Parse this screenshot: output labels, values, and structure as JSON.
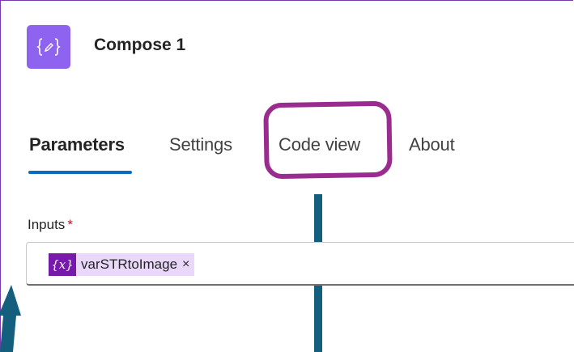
{
  "action": {
    "title": "Compose 1",
    "icon": "compose-icon",
    "icon_color": "#8e63f0"
  },
  "tabs": [
    {
      "label": "Parameters",
      "active": true
    },
    {
      "label": "Settings",
      "active": false
    },
    {
      "label": "Code view",
      "active": false
    },
    {
      "label": "About",
      "active": false
    }
  ],
  "parameters": {
    "inputs_label": "Inputs",
    "required_mark": "*",
    "token": {
      "icon_text": "{x}",
      "label": "varSTRtoImage",
      "remove": "×",
      "color": "#7719aa"
    }
  },
  "annotations": {
    "highlight_color": "#9b2c8f",
    "line_color": "#135f7d"
  }
}
